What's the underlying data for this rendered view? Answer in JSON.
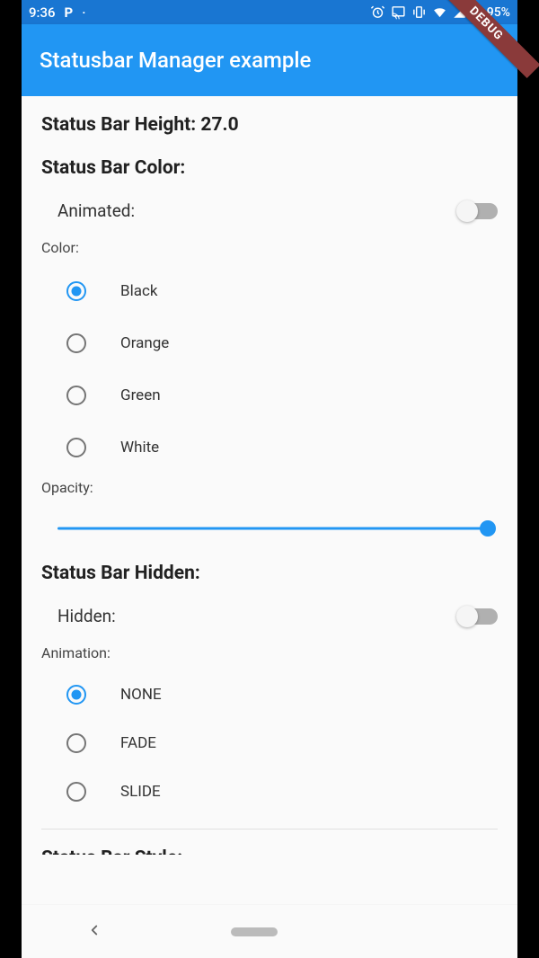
{
  "statusbar": {
    "time": "9:36",
    "app_letter": "P",
    "battery_text": "95%"
  },
  "appbar": {
    "title": "Statusbar Manager example"
  },
  "debug": {
    "label": "DEBUG"
  },
  "height_section": {
    "label": "Status Bar Height: 27.0"
  },
  "color_section": {
    "title": "Status Bar Color:",
    "animated_label": "Animated:",
    "animated_on": false,
    "color_label": "Color:",
    "options": [
      "Black",
      "Orange",
      "Green",
      "White"
    ],
    "selected_index": 0,
    "opacity_label": "Opacity:",
    "opacity_value": 1.0
  },
  "hidden_section": {
    "title": "Status Bar Hidden:",
    "hidden_label": "Hidden:",
    "hidden_on": false,
    "animation_label": "Animation:",
    "options": [
      "NONE",
      "FADE",
      "SLIDE"
    ],
    "selected_index": 0
  },
  "style_section": {
    "title_cutoff": "Status Bar Style:"
  }
}
